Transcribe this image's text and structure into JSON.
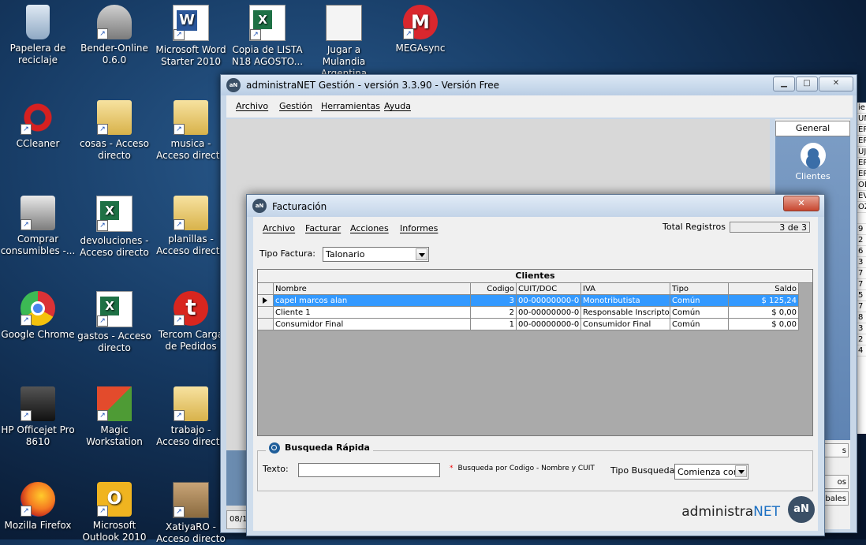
{
  "desktop": {
    "icons": [
      {
        "label": "Papelera de reciclaje"
      },
      {
        "label": "Bender-Online 0.6.0"
      },
      {
        "label": "Microsoft Word Starter 2010"
      },
      {
        "label": "Copia de LISTA N18 AGOSTO..."
      },
      {
        "label": "Jugar a Mulandia Argentina"
      },
      {
        "label": "MEGAsync"
      },
      {
        "label": "CCleaner"
      },
      {
        "label": "cosas - Acceso directo"
      },
      {
        "label": "musica - Acceso directo"
      },
      {
        "label": "Comprar consumibles -..."
      },
      {
        "label": "devoluciones - Acceso directo"
      },
      {
        "label": "planillas - Acceso directo"
      },
      {
        "label": "Google Chrome"
      },
      {
        "label": "gastos - Acceso directo"
      },
      {
        "label": "Tercom Carga de Pedidos"
      },
      {
        "label": "HP Officejet Pro 8610"
      },
      {
        "label": "Magic Workstation"
      },
      {
        "label": "trabajo - Acceso directo"
      },
      {
        "label": "Mozilla Firefox"
      },
      {
        "label": "Microsoft Outlook 2010"
      },
      {
        "label": "XatiyaRO - Acceso directo"
      }
    ]
  },
  "main_window": {
    "logo_text": "aN",
    "title": "administraNET Gestión - versión 3.3.90 - Versión Free",
    "caption_buttons": {
      "minimize": "▁",
      "maximize": "□",
      "close": "✕"
    },
    "menu": [
      "Archivo",
      "Gestión",
      "Herramientas",
      "Ayuda"
    ],
    "side_panel": {
      "tab": "General",
      "clients_label": "Clientes",
      "buttons": [
        "s",
        "os",
        "obales"
      ]
    },
    "status_text": "08/1"
  },
  "background_sheet": [
    "ie",
    "UN",
    "ER",
    "ER",
    "UJ",
    "ER",
    "ER",
    "OD",
    "EV",
    "OZ",
    "",
    "9",
    "2",
    "6",
    "3",
    "7",
    "7",
    "5",
    "7",
    "8",
    "3",
    "2",
    "4"
  ],
  "facturacion": {
    "title": "Facturación",
    "close": "✕",
    "menu": [
      "Archivo",
      "Facturar",
      "Acciones",
      "Informes"
    ],
    "total_registros_label": "Total Registros",
    "total_registros_value": "3 de 3",
    "tipo_factura_label": "Tipo Factura:",
    "tipo_factura_value": "Talonario",
    "grid": {
      "caption": "Clientes",
      "columns": [
        "Nombre",
        "Codigo",
        "CUIT/DOC",
        "IVA",
        "Tipo",
        "Saldo"
      ],
      "rows": [
        {
          "nombre": "capel marcos alan",
          "codigo": "3",
          "cuit": "00-00000000-0",
          "iva": "Monotributista",
          "tipo": "Común",
          "saldo": "$ 125,24"
        },
        {
          "nombre": "Cliente 1",
          "codigo": "2",
          "cuit": "00-00000000-0",
          "iva": "Responsable Inscripto",
          "tipo": "Común",
          "saldo": "$ 0,00"
        },
        {
          "nombre": "Consumidor Final",
          "codigo": "1",
          "cuit": "00-00000000-0",
          "iva": "Consumidor Final",
          "tipo": "Común",
          "saldo": "$ 0,00"
        }
      ]
    },
    "busqueda": {
      "title": "Busqueda Rápida",
      "texto_label": "Texto:",
      "texto_value": "",
      "hint_star": "*",
      "hint": "Busqueda por Codigo - Nombre y CUIT",
      "tipo_label": "Tipo Busqueda:",
      "tipo_value": "Comienza con"
    },
    "brand": {
      "part1": "administra",
      "part2": "NET",
      "logo": "aN"
    }
  }
}
